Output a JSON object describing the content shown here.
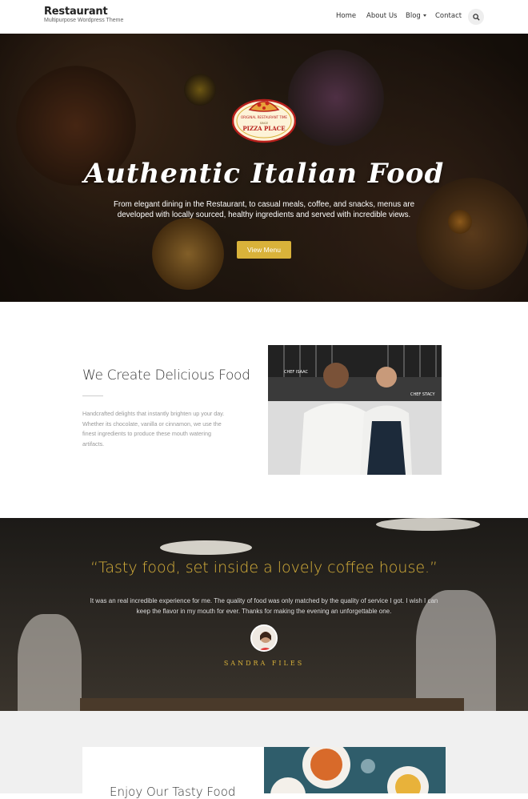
{
  "header": {
    "brand": "Restaurant",
    "tagline": "Multipurpose Wordpress Theme",
    "nav": [
      "Home",
      "About Us",
      "Blog",
      "Contact"
    ]
  },
  "hero": {
    "logo_top": "ORIGINAL RESTAURANT TIME",
    "logo_mid": "SINCE",
    "logo_name": "PIZZA PLACE",
    "title": "Authentic Italian Food",
    "text": "From elegant dining in the Restaurant, to casual meals, coffee, and snacks, menus are developed with locally sourced, healthy ingredients and served with incredible views.",
    "button": "View Menu"
  },
  "about": {
    "title": "We Create Delicious Food",
    "text": "Handcrafted delights that instantly brighten up your day. Whether its chocolate, vanilla or cinnamon, we use the finest ingredients to produce these mouth watering artifacts.",
    "chef1_label": "CHEF ISAAC",
    "chef2_label": "CHEF STACY"
  },
  "testimonial": {
    "quote": "“Tasty food, set inside a lovely coffee house.”",
    "text": "It was an real incredible experience for me. The quality of food was only matched by the quality of service I got. I wish I can keep the flavor in my mouth for ever. Thanks for making the evening an unforgettable one.",
    "name": "SANDRA FILES"
  },
  "bottom": {
    "title": "Enjoy Our Tasty Food"
  },
  "colors": {
    "accent": "#d9b23a",
    "text_dark": "#333333",
    "text_muted": "#999999"
  }
}
